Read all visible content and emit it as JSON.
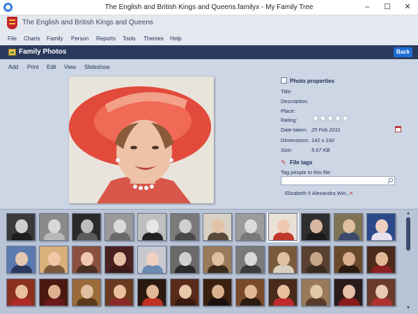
{
  "window": {
    "title": "The English and British Kings and Queens.familyx - My Family Tree",
    "minimize": "–",
    "maximize": "☐",
    "close": "✕"
  },
  "app": {
    "document_title": "The English and British Kings and Queens"
  },
  "menu": [
    "File",
    "Charts",
    "Family",
    "Person",
    "Reports",
    "Tools",
    "Themes",
    "Help"
  ],
  "page": {
    "title": "Family Photos",
    "back_label": "Back"
  },
  "toolbar": [
    "Add",
    "Print",
    "Edit",
    "View",
    "Slideshow"
  ],
  "properties": {
    "header": "Photo properties",
    "title_label": "Title:",
    "description_label": "Description:",
    "place_label": "Place:",
    "rating_label": "Rating:",
    "rating_value": 0,
    "rating_max": 5,
    "date_label": "Date taken:",
    "date_value": "25 Feb 2011",
    "dimensions_label": "Dimensions:",
    "dimensions_value": "142 x 160",
    "size_label": "Size:",
    "size_value": "5.67 KB"
  },
  "tags": {
    "header": "File tags",
    "prompt": "Tag people to this file:",
    "input_value": "",
    "items": [
      "Elizabeth II Alexandra Win..."
    ]
  },
  "thumbnails": {
    "selected_index": 8,
    "items": [
      {
        "bg": "#3a3a3a",
        "face": "#cfcfcf",
        "body": "#1e1e1e"
      },
      {
        "bg": "#8a8a8a",
        "face": "#d8d8d8",
        "body": "#b8b8b8"
      },
      {
        "bg": "#2a2a2a",
        "face": "#bdbdbd",
        "body": "#5a5a5a"
      },
      {
        "bg": "#9a9a9a",
        "face": "#dadada",
        "body": "#6a6a6a"
      },
      {
        "bg": "#bfbfbf",
        "face": "#e6e6e6",
        "body": "#222222"
      },
      {
        "bg": "#7a7a7a",
        "face": "#d0d0d0",
        "body": "#4a4a4a"
      },
      {
        "bg": "#d9d1c4",
        "face": "#e2c3a8",
        "body": "#5a4a3a"
      },
      {
        "bg": "#9c9c9c",
        "face": "#dcdcdc",
        "body": "#7a7a7a"
      },
      {
        "bg": "#e9e1d6",
        "face": "#f0c8b0",
        "body": "#c0392b"
      },
      {
        "bg": "#2e2e2e",
        "face": "#d8b8a0",
        "body": "#1b1b1b"
      },
      {
        "bg": "#7e7355",
        "face": "#e0c0a0",
        "body": "#3b4a6b"
      },
      {
        "bg": "#2c4a8a",
        "face": "#f0d0c0",
        "body": "#e8e0f0"
      },
      {
        "bg": "#5b7bb0",
        "face": "#e6c8b0",
        "body": "#2b3a5c"
      },
      {
        "bg": "#d8b07a",
        "face": "#f0c8a8",
        "body": "#7a5a3a"
      },
      {
        "bg": "#8a5040",
        "face": "#f0c8b0",
        "body": "#4a3020"
      },
      {
        "bg": "#4a2020",
        "face": "#e8c0a8",
        "body": "#3a1a1a"
      },
      {
        "bg": "#c8c8d0",
        "face": "#f0d0c0",
        "body": "#6a8ab0"
      },
      {
        "bg": "#6a6a6a",
        "face": "#cfcfcf",
        "body": "#2a2a2a"
      },
      {
        "bg": "#9a7a5a",
        "face": "#e0c0a0",
        "body": "#3a2a1a"
      },
      {
        "bg": "#7a7a7a",
        "face": "#d8d8d8",
        "body": "#3a3a3a"
      },
      {
        "bg": "#7a5a3a",
        "face": "#e0c0a0",
        "body": "#d8d0c0"
      },
      {
        "bg": "#5a4030",
        "face": "#c8a888",
        "body": "#3a2a20"
      },
      {
        "bg": "#6a4a2a",
        "face": "#d8b090",
        "body": "#2a1a10"
      },
      {
        "bg": "#4a2a1a",
        "face": "#e0b898",
        "body": "#8a2020"
      },
      {
        "bg": "#8a3020",
        "face": "#e8c0a0",
        "body": "#b02a2a"
      },
      {
        "bg": "#4a1a10",
        "face": "#e0b090",
        "body": "#6a1a1a"
      },
      {
        "bg": "#9a6a3a",
        "face": "#e0c0a0",
        "body": "#5a3a1a"
      },
      {
        "bg": "#6a3a20",
        "face": "#e8c0a0",
        "body": "#8a2a2a"
      },
      {
        "bg": "#2a1a10",
        "face": "#e0b898",
        "body": "#c03020"
      },
      {
        "bg": "#5a2a1a",
        "face": "#e8c8a8",
        "body": "#3a1a10"
      },
      {
        "bg": "#3a2010",
        "face": "#d8b090",
        "body": "#1a1010"
      },
      {
        "bg": "#7a4a2a",
        "face": "#e0b898",
        "body": "#2a1a10"
      },
      {
        "bg": "#4a2a1a",
        "face": "#e8c0a0",
        "body": "#c02a2a"
      },
      {
        "bg": "#9a7a5a",
        "face": "#e0c8a8",
        "body": "#5a3a2a"
      },
      {
        "bg": "#2a1a1a",
        "face": "#e8c0a8",
        "body": "#8a1a1a"
      },
      {
        "bg": "#6a3a2a",
        "face": "#e8c8b0",
        "body": "#b03030"
      }
    ]
  },
  "colors": {
    "header_bar": "#2b3a5c",
    "back_button": "#1e6ed8",
    "panel": "#cdd6e5",
    "strip": "#b9c4d6"
  }
}
